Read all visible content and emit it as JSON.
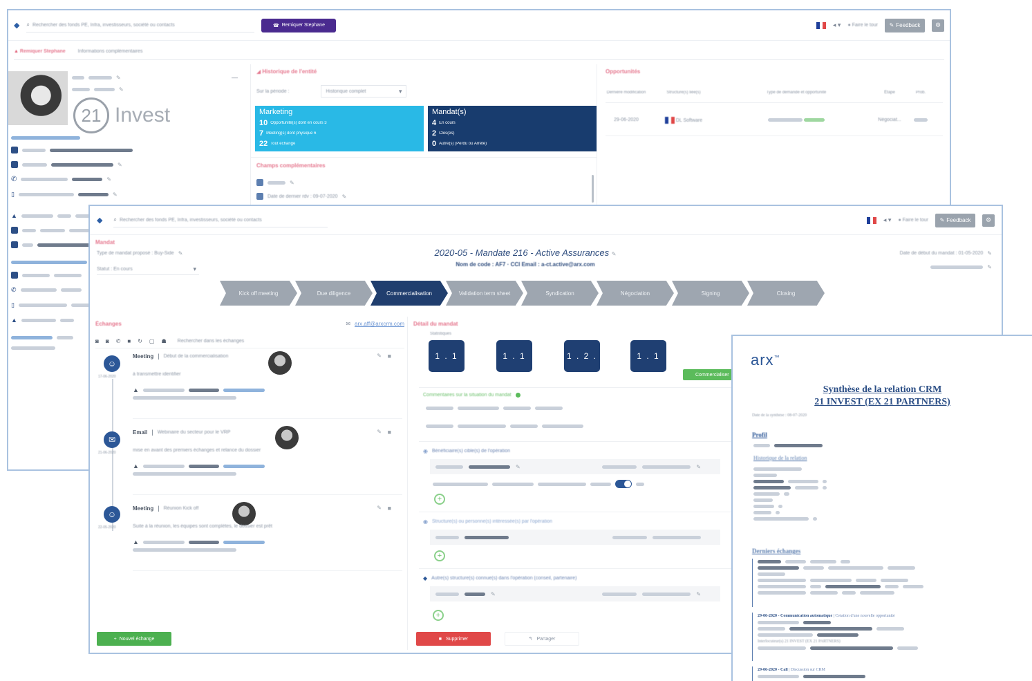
{
  "crm_back": {
    "search_placeholder": "Rechercher des fonds PE, Infra, investisseurs, société ou contacts",
    "call_button": "Remiquer Stephane",
    "tabs": [
      "Remiquer Stephane",
      "Informations complémentaires"
    ],
    "nav_tour": "Faire le tour",
    "feedback": "Feedback",
    "logo_number": "21",
    "logo_text": "Invest",
    "historique_title": "Historique de l'entité",
    "sur_la_periode": "Sur la période :",
    "periode_value": "Historique complet",
    "marketing": {
      "title": "Marketing",
      "lines": [
        {
          "num": "10",
          "text": "Opportunité(s) dont en cours 3"
        },
        {
          "num": "7",
          "text": "Meeting(s) dont physique 6"
        },
        {
          "num": "22",
          "text": "Tout échange"
        }
      ]
    },
    "mandats": {
      "title": "Mandat(s)",
      "lines": [
        {
          "num": "4",
          "text": "En cours"
        },
        {
          "num": "2",
          "text": "Clos(es)"
        },
        {
          "num": "0",
          "text": "Autre(s) (Perdu ou Arrêté)"
        }
      ]
    },
    "champs_title": "Champs complémentaires",
    "champ_date": "Date de dernier rdv : 09-07-2020",
    "opportunities_title": "Opportunités",
    "opp_headers": [
      "Dernière modification",
      "Structure(s) liée(s)",
      "Type de demande et opportunité",
      "Étape",
      "Prob."
    ],
    "opp_row": {
      "date": "29-06-2020",
      "entity": "DL Software",
      "stage": "Négociat..."
    }
  },
  "mandate": {
    "search_placeholder": "Rechercher des fonds PE, Infra, investisseurs, société ou contacts",
    "nav_tour": "Faire le tour",
    "feedback": "Feedback",
    "section_label": "Mandat",
    "field_type": "Type de mandat proposé : Buy-Side",
    "field_statut": "Statut : En cours",
    "title": "2020-05 - Mandate 216 - Active Assurances",
    "subtitle": "Nom de code : AF7 · CCI Email : a-ct.active@arx.com",
    "date_debut": "Date de début du mandat : 01-05-2020",
    "stages": [
      "Kick off meeting",
      "Due diligence",
      "Commercialisation",
      "Validation term sheet",
      "Syndication",
      "Négociation",
      "Signing",
      "Closing"
    ],
    "echanges_title": "Échanges",
    "echanges_email": "arx.aff@arxcrm.com",
    "echanges_search": "Rechercher dans les échanges",
    "timeline": [
      {
        "date": "17-06-2020",
        "type": "Meeting",
        "subject": "Début de la commercialisation",
        "desc": "à transmettre identifier"
      },
      {
        "date": "21-06-2020",
        "type": "Email",
        "subject": "Webinaire du secteur pour le VRP",
        "desc": "mise en avant des premiers échanges et relance du dossier"
      },
      {
        "date": "22-05-2020",
        "type": "Meeting",
        "subject": "Réunion Kick off",
        "desc": "Suite à la réunion, les équipes sont complètes, le dossier est prêt"
      }
    ],
    "detail_title": "Détail du mandat",
    "detail_sub": "Statistiques",
    "tile_labels": [
      "1 . 1",
      "1 . 1",
      "1 . 2 .",
      "1 . 1"
    ],
    "green_btn": "Commercialiser",
    "comment": "Commentaires sur la situation du mandat",
    "block_a": "Bénéficiaire(s) cible(s) de l'opération",
    "block_b": "Structure(s) ou personne(s) intéressée(s) par l'opération",
    "block_c": "Autre(s) structure(s) connue(s) dans l'opération (conseil, partenaire)",
    "new_exchange": "Nouvel échange",
    "delete": "Supprimer",
    "partager": "Partager"
  },
  "report": {
    "logo": "arx",
    "title_line1": "Synthèse de la relation CRM",
    "title_line2": "21 INVEST (EX 21 PARTNERS)",
    "date_line": "Date de la synthèse : 08-07-2020",
    "profil": "Profil",
    "historique": "Historique de la relation",
    "derniers": "Derniers échanges",
    "entry1_head": "29-06-2020 - Communication automatique",
    "entry1_rest": "Création d'une nouvelle opportunité",
    "entry1_l2": "Interlocuteur(s) 21 INVEST (EX 21 PARTNERS)",
    "entry2_head": "29-06-2020 - Call",
    "entry2_rest": "Discussion sur CRM"
  },
  "colors": {
    "navy": "#203e6e",
    "cyan": "#29b9e6",
    "pink": "#e5788f",
    "green": "#5bbb5b",
    "red": "#e04848"
  }
}
